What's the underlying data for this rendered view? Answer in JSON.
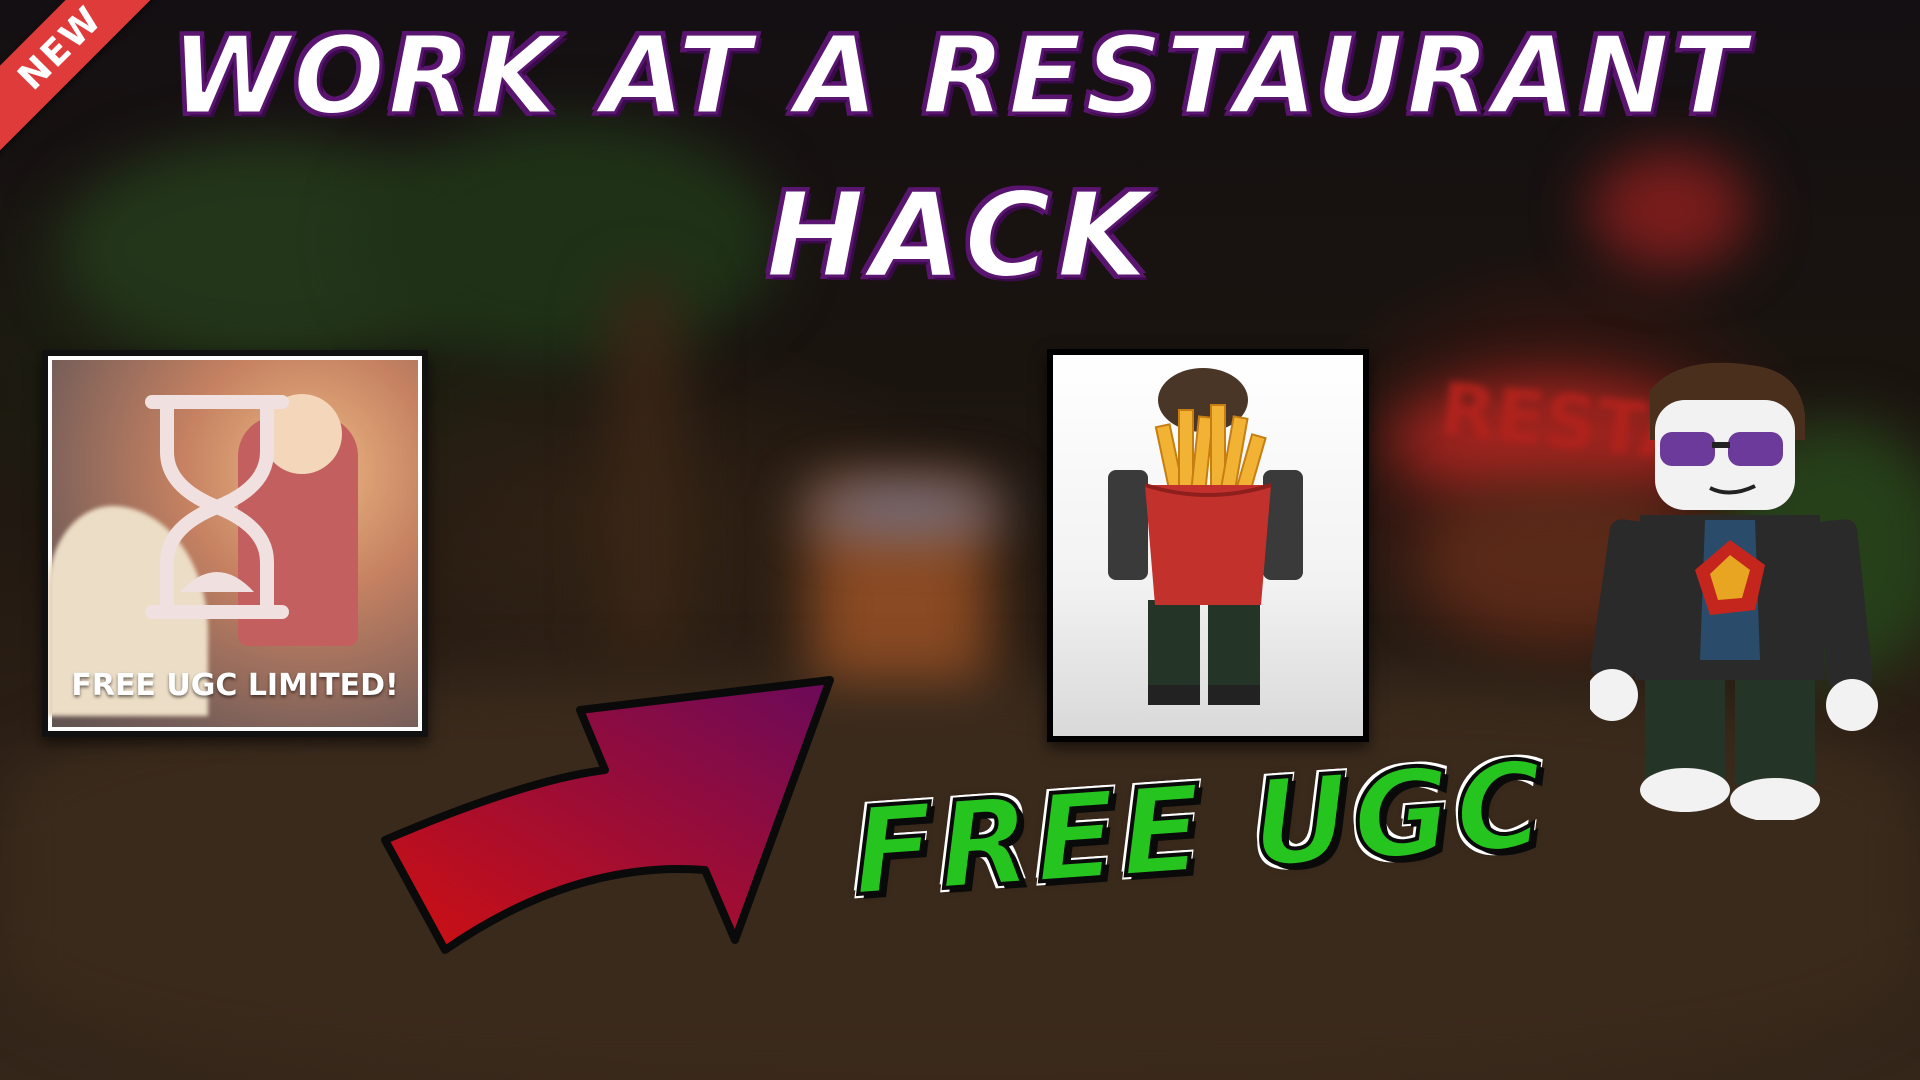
{
  "ribbon": {
    "label": "NEW"
  },
  "title": {
    "line1": "WORK AT A RESTAURANT",
    "line2": "HACK"
  },
  "left_card": {
    "label": "FREE UGC LIMITED!",
    "icon": "hourglass-icon"
  },
  "right_card": {
    "icon": "fries-backpack-avatar"
  },
  "callout": {
    "label": "FREE UGC",
    "color": "#26c41f"
  },
  "arrow": {
    "icon": "curved-arrow-icon",
    "colors": [
      "#6a0a5a",
      "#d01010"
    ]
  },
  "character": {
    "icon": "roblox-avatar-sunglasses"
  },
  "background": {
    "sign_text": "RESTA"
  }
}
